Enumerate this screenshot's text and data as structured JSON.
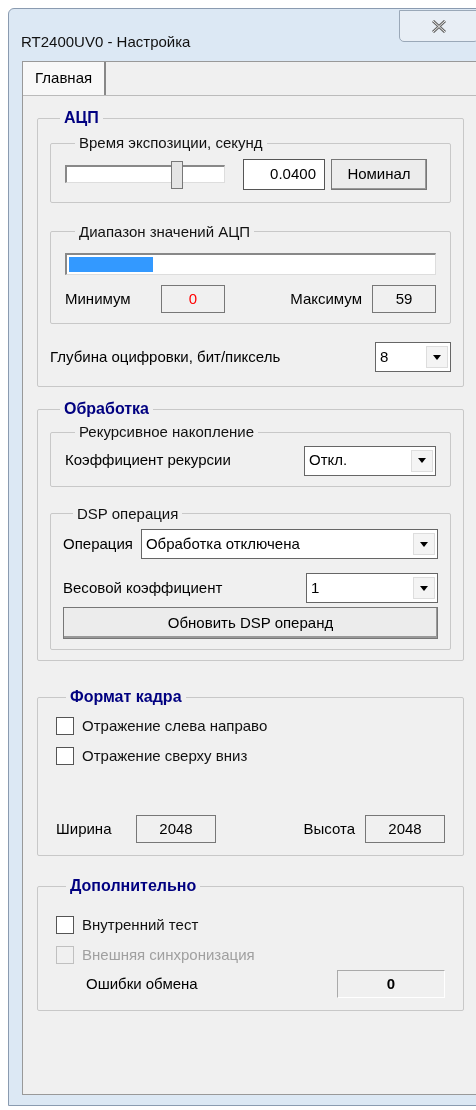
{
  "window": {
    "title": "RT2400UV0 - Настройка"
  },
  "tabs": [
    {
      "label": "Главная",
      "selected": true
    }
  ],
  "adc": {
    "title": "АЦП",
    "exposure": {
      "title": "Время экспозиции, секунд",
      "slider": {
        "level": 0.7
      },
      "value": "0.0400",
      "button": "Номинал"
    },
    "range": {
      "title": "Диапазон значений  АЦП",
      "bar": {
        "level": 0.23
      },
      "min_label": "Минимум",
      "min_value": "0",
      "max_label": "Максимум",
      "max_value": "59"
    },
    "depth": {
      "label": "Глубина оцифровки, бит/пиксель",
      "value": "8"
    }
  },
  "processing": {
    "title": "Обработка",
    "recursive": {
      "title": "Рекурсивное накопление",
      "label": "Коэффициент рекурсии",
      "value": "Откл."
    },
    "dsp": {
      "title": "DSP операция",
      "operation_label": "Операция",
      "operation_value": "Обработка отключена",
      "weight_label": "Весовой коэффициент",
      "weight_value": "1",
      "button": "Обновить DSP операнд"
    }
  },
  "frame": {
    "title": "Формат кадра",
    "checkboxes": [
      {
        "label": "Отражение слева направо",
        "checked": false,
        "disabled": false
      },
      {
        "label": "Отражение сверху вниз",
        "checked": false,
        "disabled": false
      }
    ],
    "width_label": "Ширина",
    "width_value": "2048",
    "height_label": "Высота",
    "height_value": "2048"
  },
  "extra": {
    "title": "Дополнительно",
    "checkboxes": [
      {
        "label": "Внутренний тест",
        "checked": false,
        "disabled": false
      },
      {
        "label": "Внешняя синхронизация",
        "checked": false,
        "disabled": true
      }
    ],
    "errors_label": "Ошибки обмена",
    "errors_value": "0"
  }
}
